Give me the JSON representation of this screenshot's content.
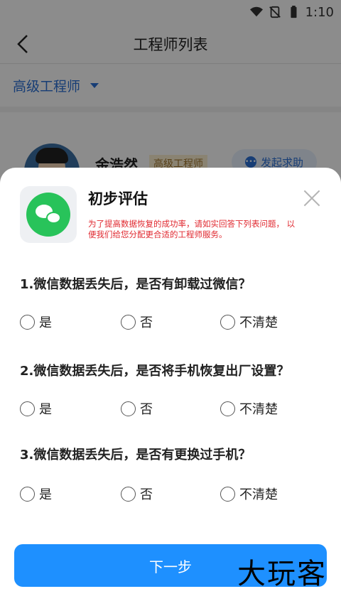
{
  "status_bar": {
    "time": "1:10"
  },
  "header": {
    "title": "工程师列表"
  },
  "filter": {
    "label": "高级工程师"
  },
  "engineer": {
    "name": "金浩然",
    "badge": "高级工程师",
    "help_label": "发起求助"
  },
  "sheet": {
    "title": "初步评估",
    "description": "为了提高数据恢复的成功率，请如实回答下列表问题， 以便我们给您分配更合适的工程师服务。",
    "questions": [
      {
        "text": "1.微信数据丢失后，是否有卸载过微信？",
        "options": [
          "是",
          "否",
          "不清楚"
        ]
      },
      {
        "text": "2.微信数据丢失后，是否将手机恢复出厂设置？",
        "options": [
          "是",
          "否",
          "不清楚"
        ]
      },
      {
        "text": "3.微信数据丢失后，是否有更换过手机？",
        "options": [
          "是",
          "否",
          "不清楚"
        ]
      }
    ],
    "next_label": "下一步"
  },
  "watermark": "大玩客",
  "colors": {
    "accent": "#1e90ff",
    "warning_text": "#e0282f",
    "wechat_green": "#28c35a"
  }
}
